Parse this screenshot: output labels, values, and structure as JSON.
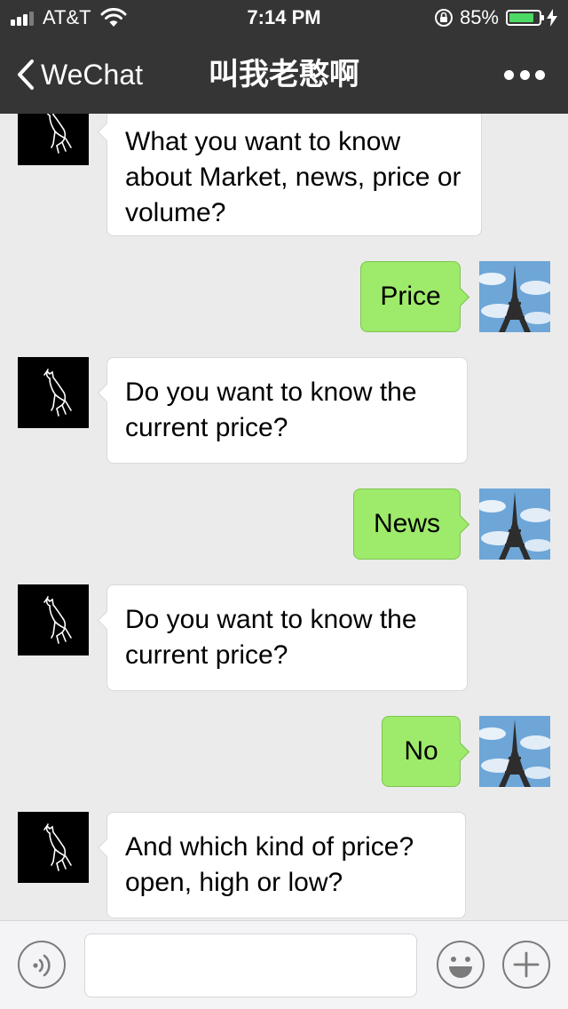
{
  "status_bar": {
    "carrier": "AT&T",
    "time": "7:14 PM",
    "battery_percent": "85%",
    "battery_level": 0.85,
    "icons": [
      "signal-icon",
      "wifi-icon",
      "orientation-lock-icon",
      "battery-icon",
      "charging-icon"
    ]
  },
  "nav": {
    "back_label": "WeChat",
    "title": "叫我老憨啊",
    "more_icon": "more-dots-icon"
  },
  "messages": [
    {
      "from": "bot",
      "text": "What you want to know about Market, news, price or volume?"
    },
    {
      "from": "user",
      "text": "Price"
    },
    {
      "from": "bot",
      "text": "Do you want to know the current price?"
    },
    {
      "from": "user",
      "text": "News"
    },
    {
      "from": "bot",
      "text": "Do you want to know the current price?"
    },
    {
      "from": "user",
      "text": "No"
    },
    {
      "from": "bot",
      "text": "And which kind of price? open, high or low?"
    }
  ],
  "input_bar": {
    "text_value": "",
    "icons": [
      "voice-icon",
      "emoji-icon",
      "plus-icon"
    ]
  },
  "colors": {
    "header_bg": "#353535",
    "chat_bg": "#ebebeb",
    "outgoing_bubble": "#9eea6a",
    "incoming_bubble": "#ffffff",
    "battery_fill": "#4cd964"
  }
}
